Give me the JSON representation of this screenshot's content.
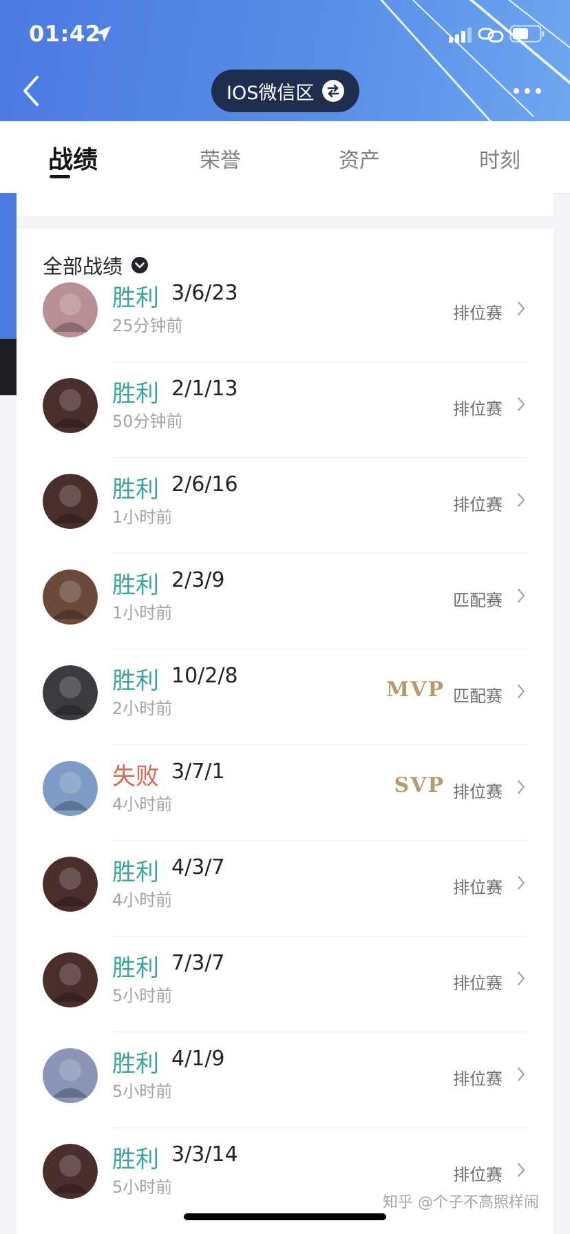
{
  "status_bar": {
    "time": "01:42"
  },
  "header": {
    "server_label": "IOS微信区"
  },
  "tabs": [
    {
      "label": "战绩",
      "active": true
    },
    {
      "label": "荣誉",
      "active": false
    },
    {
      "label": "资产",
      "active": false
    },
    {
      "label": "时刻",
      "active": false
    }
  ],
  "section": {
    "title": "全部战绩"
  },
  "matches": [
    {
      "result": "胜利",
      "outcome": "win",
      "kda": "3/6/23",
      "time_ago": "25分钟前",
      "mode": "排位赛",
      "badge": "",
      "avatar_color": "#b98f96"
    },
    {
      "result": "胜利",
      "outcome": "win",
      "kda": "2/1/13",
      "time_ago": "50分钟前",
      "mode": "排位赛",
      "badge": "",
      "avatar_color": "#4a2e2c"
    },
    {
      "result": "胜利",
      "outcome": "win",
      "kda": "2/6/16",
      "time_ago": "1小时前",
      "mode": "排位赛",
      "badge": "",
      "avatar_color": "#4a2e2c"
    },
    {
      "result": "胜利",
      "outcome": "win",
      "kda": "2/3/9",
      "time_ago": "1小时前",
      "mode": "匹配赛",
      "badge": "",
      "avatar_color": "#6b4a3c"
    },
    {
      "result": "胜利",
      "outcome": "win",
      "kda": "10/2/8",
      "time_ago": "2小时前",
      "mode": "匹配赛",
      "badge": "MVP",
      "avatar_color": "#3c3a40"
    },
    {
      "result": "失败",
      "outcome": "lose",
      "kda": "3/7/1",
      "time_ago": "4小时前",
      "mode": "排位赛",
      "badge": "SVP",
      "avatar_color": "#7d9bc4"
    },
    {
      "result": "胜利",
      "outcome": "win",
      "kda": "4/3/7",
      "time_ago": "4小时前",
      "mode": "排位赛",
      "badge": "",
      "avatar_color": "#4a2e2c"
    },
    {
      "result": "胜利",
      "outcome": "win",
      "kda": "7/3/7",
      "time_ago": "5小时前",
      "mode": "排位赛",
      "badge": "",
      "avatar_color": "#4a2e2c"
    },
    {
      "result": "胜利",
      "outcome": "win",
      "kda": "4/1/9",
      "time_ago": "5小时前",
      "mode": "排位赛",
      "badge": "",
      "avatar_color": "#8a95b8"
    },
    {
      "result": "胜利",
      "outcome": "win",
      "kda": "3/3/14",
      "time_ago": "5小时前",
      "mode": "排位赛",
      "badge": "",
      "avatar_color": "#4a2e2c"
    }
  ],
  "watermark": "知乎 @个子不高照样闹",
  "colors": {
    "win": "#3ea39d",
    "lose": "#d9674f",
    "badge_gold": "#b89a6b",
    "header_blue": "#4a79e0"
  }
}
